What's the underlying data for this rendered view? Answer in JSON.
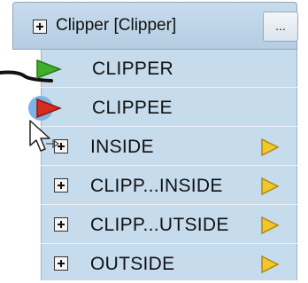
{
  "transformer": {
    "title": "Clipper [Clipper]",
    "more_button_label": "...",
    "input_ports": [
      {
        "label": "CLIPPER",
        "arrow_color": "#3fae2a",
        "connected": true
      },
      {
        "label": "CLIPPEE",
        "arrow_color": "#d62b1e",
        "connected": false
      }
    ],
    "output_ports": [
      {
        "label": "INSIDE",
        "arrow_color": "#f2c72b"
      },
      {
        "label": "CLIPP...INSIDE",
        "arrow_color": "#f2c72b"
      },
      {
        "label": "CLIPP...UTSIDE",
        "arrow_color": "#f2c72b"
      },
      {
        "label": "OUTSIDE",
        "arrow_color": "#f2c72b"
      }
    ]
  },
  "colors": {
    "panel": "#c6dced",
    "header": "#b8d0e4",
    "connection_line": "#111111"
  },
  "icons": [
    "expand-plus-icon",
    "input-arrow-icon",
    "output-arrow-icon",
    "mouse-cursor-icon"
  ]
}
